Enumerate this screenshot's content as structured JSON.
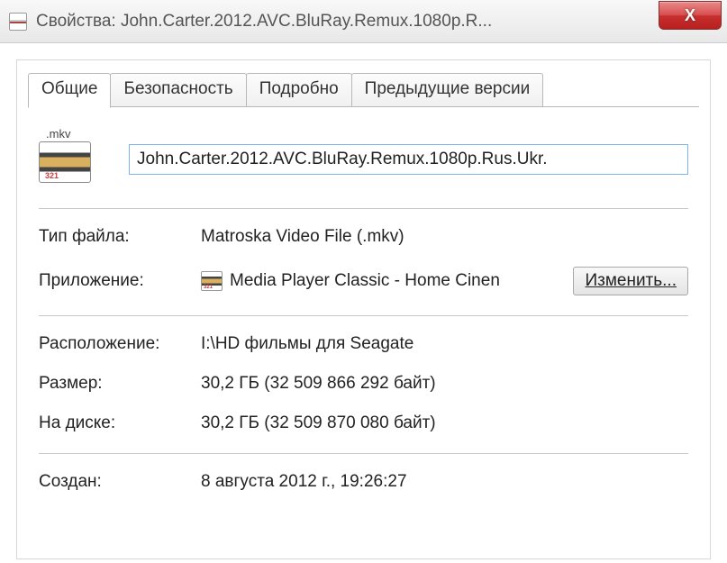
{
  "window": {
    "title": "Свойства: John.Carter.2012.AVC.BluRay.Remux.1080p.R...",
    "close_glyph": "X"
  },
  "tabs": {
    "general": "Общие",
    "security": "Безопасность",
    "details": "Подробно",
    "previous": "Предыдущие версии"
  },
  "file": {
    "ext_badge": ".mkv",
    "name": "John.Carter.2012.AVC.BluRay.Remux.1080p.Rus.Ukr."
  },
  "labels": {
    "type": "Тип файла:",
    "app": "Приложение:",
    "location": "Расположение:",
    "size": "Размер:",
    "ondisk": "На диске:",
    "created": "Создан:"
  },
  "values": {
    "type": "Matroska Video File (.mkv)",
    "app": "Media Player Classic - Home Cinen",
    "change_btn": "Изменить...",
    "location": "I:\\HD фильмы для Seagate",
    "size": "30,2 ГБ (32 509 866 292 байт)",
    "ondisk": "30,2 ГБ (32 509 870 080 байт)",
    "created": "8 августа 2012 г., 19:26:27"
  }
}
